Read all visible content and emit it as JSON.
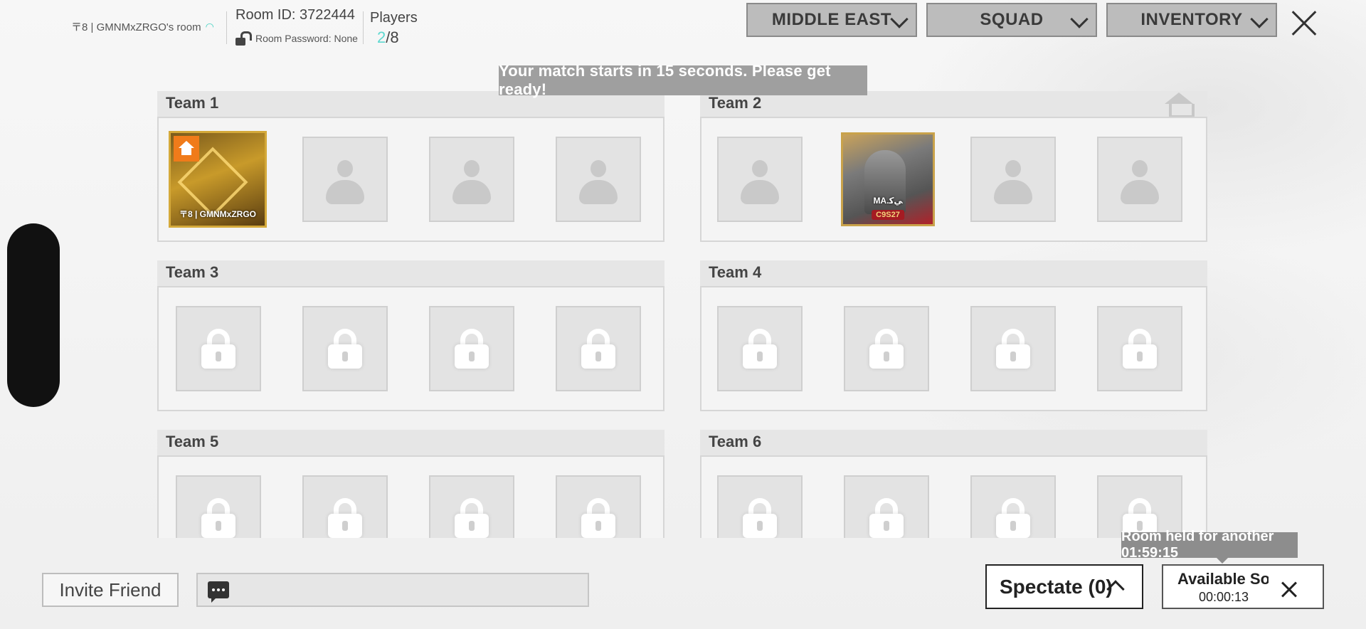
{
  "header": {
    "room_name": "〒8 | GMNMxZRGO's room",
    "room_id": "Room ID: 3722444",
    "room_password": "Room Password: None",
    "players_label": "Players",
    "players_current": "2",
    "players_max": "/8",
    "region": "MIDDLE EAST",
    "mode": "SQUAD",
    "inventory": "INVENTORY"
  },
  "notice": "Your match starts in 15 seconds. Please get ready!",
  "teams": [
    {
      "name": "Team 1"
    },
    {
      "name": "Team 2"
    },
    {
      "name": "Team 3"
    },
    {
      "name": "Team 4"
    },
    {
      "name": "Team 5"
    },
    {
      "name": "Team 6"
    }
  ],
  "players": {
    "host": {
      "name": "〒8 | GMNMxZRGO"
    },
    "member": {
      "name": "MA.ﻲﻛ",
      "tag": "C9S27"
    }
  },
  "footer": {
    "invite_label": "Invite Friend",
    "spectate_label": "Spectate (0)",
    "room_held": "Room held for another 01:59:15",
    "available_label": "Available Soon",
    "available_time": "00:00:13"
  }
}
